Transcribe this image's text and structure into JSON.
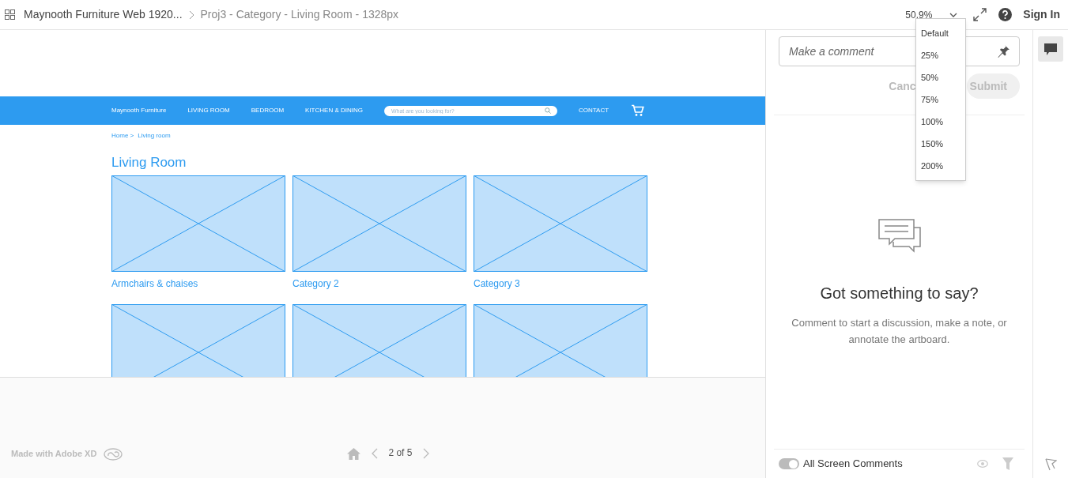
{
  "topbar": {
    "project": "Maynooth Furniture Web 1920...",
    "screen": "Proj3 - Category - Living Room - 1328px",
    "zoom": "50.9%",
    "sign_in": "Sign In"
  },
  "zoom_menu": [
    "Default",
    "25%",
    "50%",
    "75%",
    "100%",
    "150%",
    "200%"
  ],
  "artboard": {
    "brand": "Maynooth Furniture",
    "nav": [
      "LIVING ROOM",
      "BEDROOM",
      "KITCHEN & DINING"
    ],
    "search_placeholder": "What are you looking for?",
    "contact": "CONTACT",
    "breadcrumb": [
      "Home >",
      "Living room"
    ],
    "heading": "Living Room",
    "tiles": [
      {
        "kind": "labeled",
        "label": "Armchairs & chaises"
      },
      {
        "kind": "labeled",
        "label": "Category 2"
      },
      {
        "kind": "labeled",
        "label": "Category 3"
      },
      {
        "kind": "plain"
      },
      {
        "kind": "plain"
      },
      {
        "kind": "plain"
      }
    ]
  },
  "footer": {
    "made_with": "Made with Adobe XD",
    "pager": "2 of 5"
  },
  "comments": {
    "placeholder": "Make a comment",
    "cancel": "Canc",
    "submit": "Submit",
    "empty_title": "Got something to say?",
    "empty_text": "Comment to start a discussion, make a note, or annotate the artboard.",
    "toggle_label": "All Screen Comments",
    "toggle_on": true
  }
}
